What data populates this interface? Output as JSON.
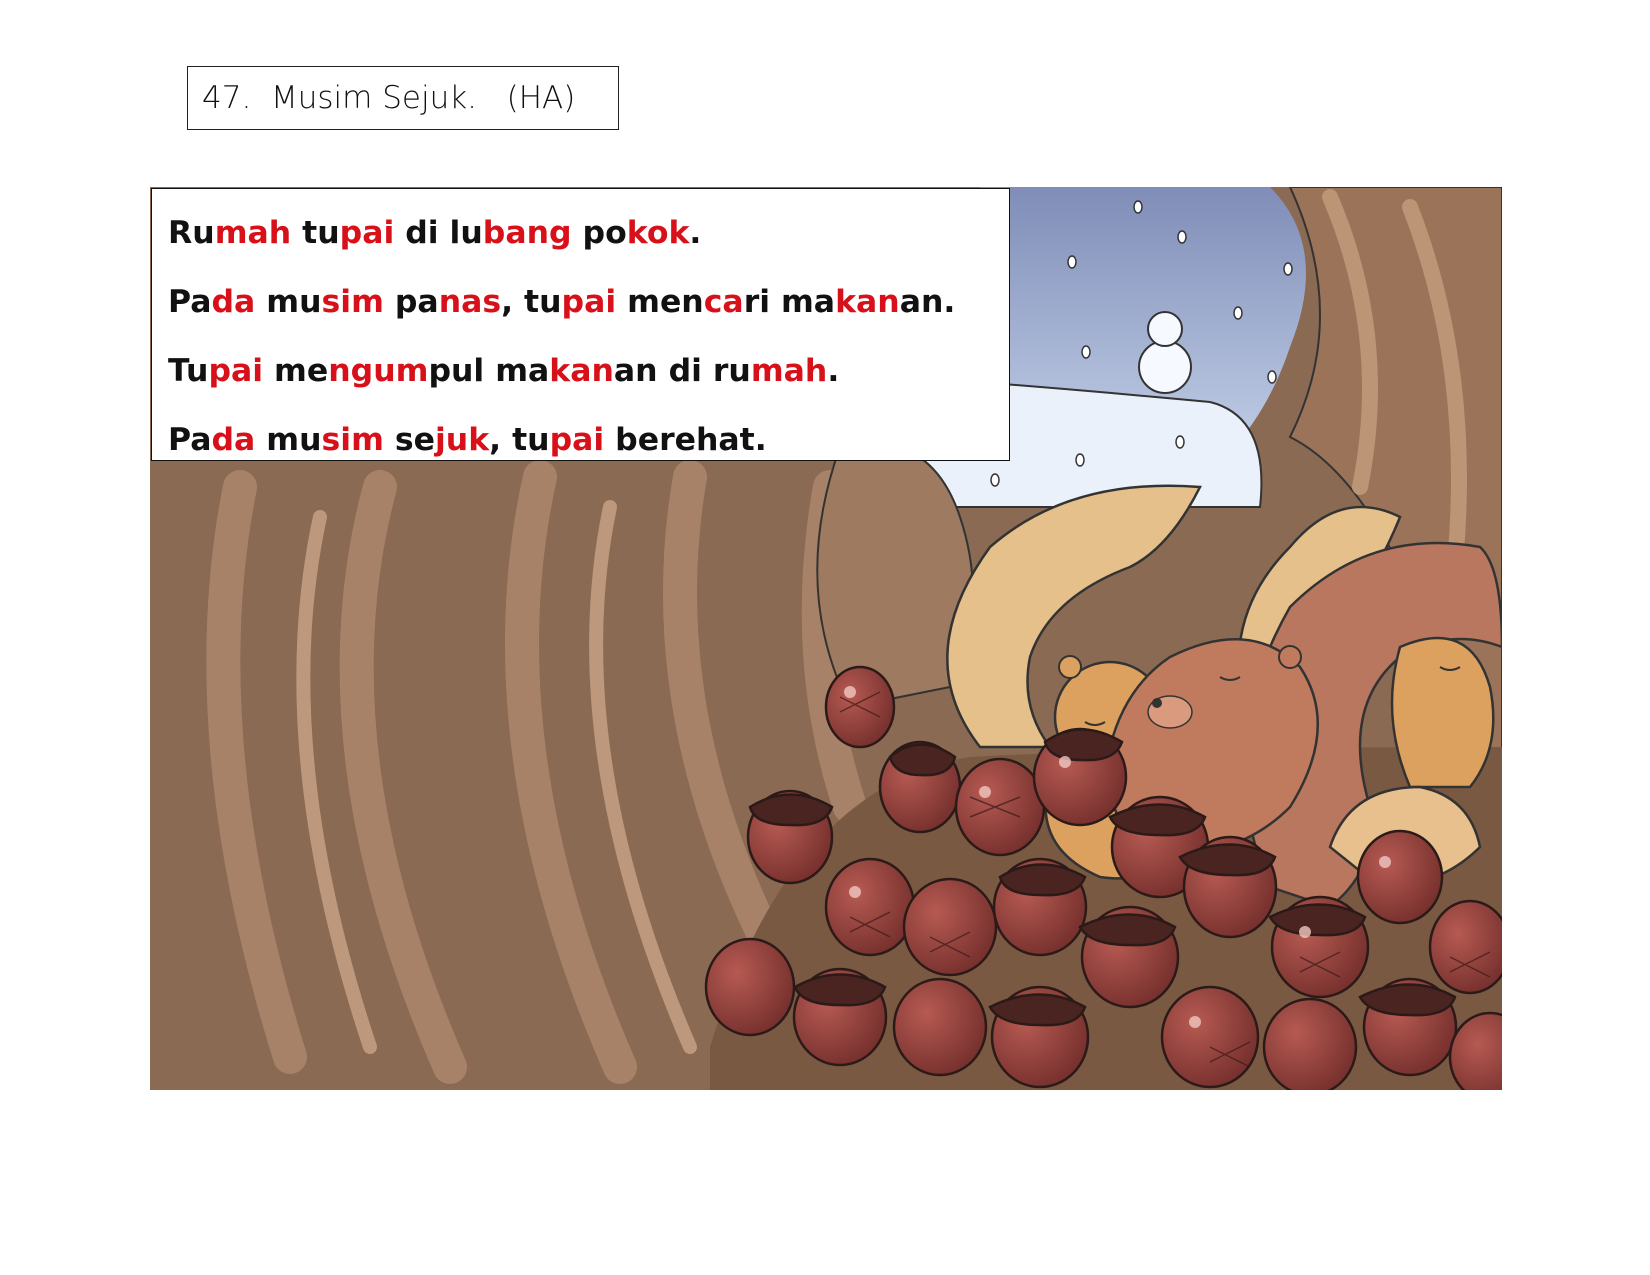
{
  "worksheet": {
    "title": "47.  Musim Sejuk.   (HA)"
  },
  "reading_box": {
    "sentences": [
      {
        "segments": [
          {
            "t": "Ru",
            "h": false
          },
          {
            "t": "mah",
            "h": true
          },
          {
            "t": " tu",
            "h": false
          },
          {
            "t": "pai",
            "h": true
          },
          {
            "t": " di lu",
            "h": false
          },
          {
            "t": "bang",
            "h": true
          },
          {
            "t": " po",
            "h": false
          },
          {
            "t": "kok",
            "h": true
          },
          {
            "t": ".",
            "h": false
          }
        ]
      },
      {
        "segments": [
          {
            "t": "Pa",
            "h": false
          },
          {
            "t": "da",
            "h": true
          },
          {
            "t": " mu",
            "h": false
          },
          {
            "t": "sim",
            "h": true
          },
          {
            "t": " pa",
            "h": false
          },
          {
            "t": "nas",
            "h": true
          },
          {
            "t": ", tu",
            "h": false
          },
          {
            "t": "pai",
            "h": true
          },
          {
            "t": " men",
            "h": false
          },
          {
            "t": "ca",
            "h": true
          },
          {
            "t": "ri ma",
            "h": false
          },
          {
            "t": "kan",
            "h": true
          },
          {
            "t": "an.",
            "h": false
          }
        ]
      },
      {
        "segments": [
          {
            "t": "Tu",
            "h": false
          },
          {
            "t": "pai",
            "h": true
          },
          {
            "t": " me",
            "h": false
          },
          {
            "t": "ngum",
            "h": true
          },
          {
            "t": "pul ma",
            "h": false
          },
          {
            "t": "kan",
            "h": true
          },
          {
            "t": "an di ru",
            "h": false
          },
          {
            "t": "mah",
            "h": true
          },
          {
            "t": ".",
            "h": false
          }
        ]
      },
      {
        "segments": [
          {
            "t": "Pa",
            "h": false
          },
          {
            "t": "da",
            "h": true
          },
          {
            "t": " mu",
            "h": false
          },
          {
            "t": "sim",
            "h": true
          },
          {
            "t": " se",
            "h": false
          },
          {
            "t": "juk",
            "h": true
          },
          {
            "t": ", tu",
            "h": false
          },
          {
            "t": "pai",
            "h": true
          },
          {
            "t": " berehat.",
            "h": false
          }
        ]
      }
    ]
  },
  "colors": {
    "highlight": "#d8101a",
    "text": "#111111",
    "sky": "#8a99c4",
    "snow": "#eaf1fb",
    "bark": "#8a6a52",
    "acorn": "#8c3a35"
  },
  "illustration": {
    "description_icon": "squirrels-sleeping-on-acorns-illustration"
  }
}
